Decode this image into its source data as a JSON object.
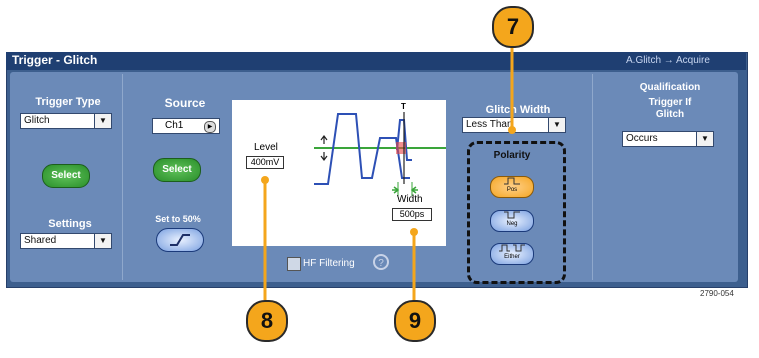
{
  "window": {
    "title": "Trigger - Glitch",
    "breadcrumb": "A.Glitch → Acquire"
  },
  "trigger_type": {
    "label": "Trigger Type",
    "value": "Glitch",
    "select_label": "Select"
  },
  "settings": {
    "label": "Settings",
    "value": "Shared"
  },
  "source": {
    "label": "Source",
    "value": "Ch1",
    "select_label": "Select",
    "set50_label": "Set to 50%"
  },
  "diagram": {
    "level_label": "Level",
    "level_value": "400mV",
    "width_label": "Width",
    "width_value": "500ps",
    "trigger_marker": "T"
  },
  "hf_filtering": {
    "label": "HF Filtering",
    "checked": false
  },
  "glitch_width": {
    "label": "Glitch Width",
    "value": "Less Than"
  },
  "polarity": {
    "label": "Polarity",
    "buttons": [
      {
        "label": "Pos",
        "selected": true
      },
      {
        "label": "Neg",
        "selected": false
      },
      {
        "label": "Either",
        "selected": false
      }
    ]
  },
  "qualification": {
    "label": "Qualification",
    "trigger_if_label": "Trigger If\nGlitch",
    "value": "Occurs"
  },
  "callouts": [
    "7",
    "8",
    "9"
  ],
  "figure_number": "2790-054",
  "colors": {
    "panel": "#3d5f8e",
    "panel_inner": "#6b8ab8",
    "select_green": "#3aa53a",
    "callout_orange": "#f4a61c",
    "selected_polarity": "#f5a623"
  }
}
